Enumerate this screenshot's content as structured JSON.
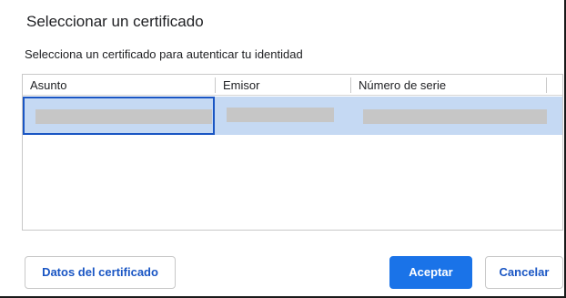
{
  "dialog": {
    "title": "Seleccionar un certificado",
    "subtitle": "Selecciona un certificado para autenticar tu identidad"
  },
  "table": {
    "columns": [
      "Asunto",
      "Emisor",
      "Número de serie"
    ],
    "rows": [
      {
        "asunto": "",
        "emisor": "",
        "numero_de_serie": "",
        "selected": true,
        "redacted": true
      }
    ]
  },
  "buttons": {
    "details_label": "Datos del certificado",
    "accept_label": "Aceptar",
    "cancel_label": "Cancelar"
  },
  "colors": {
    "accent": "#1a73e8",
    "selected_row": "#c5d9f3",
    "focus_border": "#1a56c4"
  }
}
